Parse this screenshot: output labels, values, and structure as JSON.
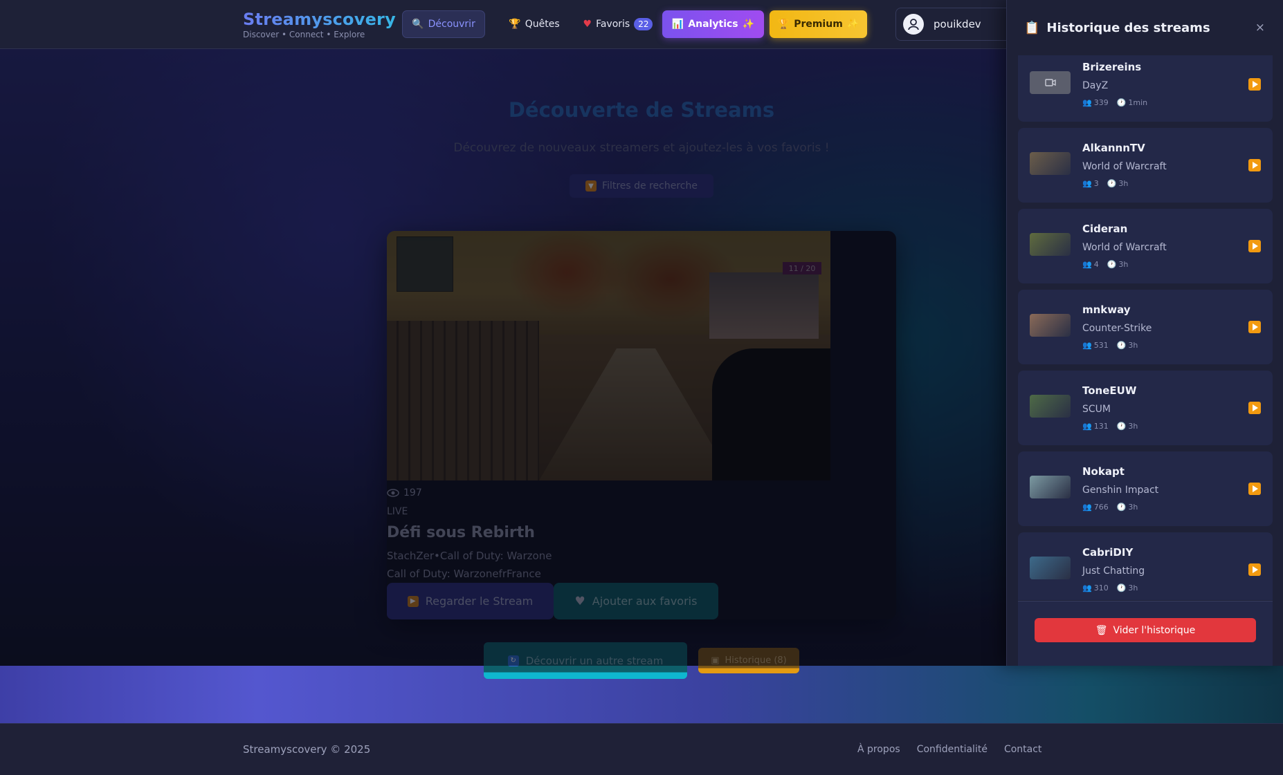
{
  "brand": {
    "name": "Streamyscovery",
    "tagline": "Discover • Connect • Explore"
  },
  "nav": {
    "discover": {
      "icon": "search-icon",
      "label": "Découvrir"
    },
    "quests": {
      "icon": "trophy-icon",
      "label": "Quêtes"
    },
    "favorites": {
      "icon": "heart-icon",
      "label": "Favoris",
      "badge": "22"
    },
    "analytics": {
      "icon": "chart-icon",
      "label": "Analytics",
      "sparkle": "✨"
    },
    "premium": {
      "icon": "trophy-icon",
      "label": "Premium",
      "sparkle": "✨"
    }
  },
  "user": {
    "name": "pouikdev",
    "avatar_icon": "user-avatar-icon"
  },
  "main": {
    "title": "Découverte de Streams",
    "subtitle": "Découvrez de nouveaux streamers et ajoutez-les à vos favoris !",
    "filters_label": "Filtres de recherche"
  },
  "stream": {
    "viewers": "197",
    "status": "LIVE",
    "title": "Défi sous Rebirth",
    "meta": "StachZer•Call of Duty: Warzone",
    "language_line": "Call of Duty: WarzonefrFrance",
    "thumb_counter": "11 / 20",
    "watch_label": "Regarder le Stream",
    "favorite_label": "Ajouter aux favoris"
  },
  "actions": {
    "discover_another": "Découvrir un autre stream",
    "history_label": "Historique (8)"
  },
  "footer": {
    "copyright": "Streamyscovery © 2025",
    "links": [
      "À propos",
      "Confidentialité",
      "Contact"
    ]
  },
  "history": {
    "title": "Historique des streams",
    "close": "×",
    "clear_label": "Vider l'historique",
    "items": [
      {
        "name": "Brizereins",
        "game": "DayZ",
        "viewers": "339",
        "ago": "1min",
        "thumb": "placeholder"
      },
      {
        "name": "AlkannnTV",
        "game": "World of Warcraft",
        "viewers": "3",
        "ago": "3h",
        "thumb": "#6b5d4a"
      },
      {
        "name": "Cideran",
        "game": "World of Warcraft",
        "viewers": "4",
        "ago": "3h",
        "thumb": "#5f6b3e"
      },
      {
        "name": "mnkway",
        "game": "Counter-Strike",
        "viewers": "531",
        "ago": "3h",
        "thumb": "#8a6a58"
      },
      {
        "name": "ToneEUW",
        "game": "SCUM",
        "viewers": "131",
        "ago": "3h",
        "thumb": "#4e6a46"
      },
      {
        "name": "Nokapt",
        "game": "Genshin Impact",
        "viewers": "766",
        "ago": "3h",
        "thumb": "#7c9aa2"
      },
      {
        "name": "CabriDIY",
        "game": "Just Chatting",
        "viewers": "310",
        "ago": "3h",
        "thumb": "#3d6a8a"
      }
    ]
  }
}
